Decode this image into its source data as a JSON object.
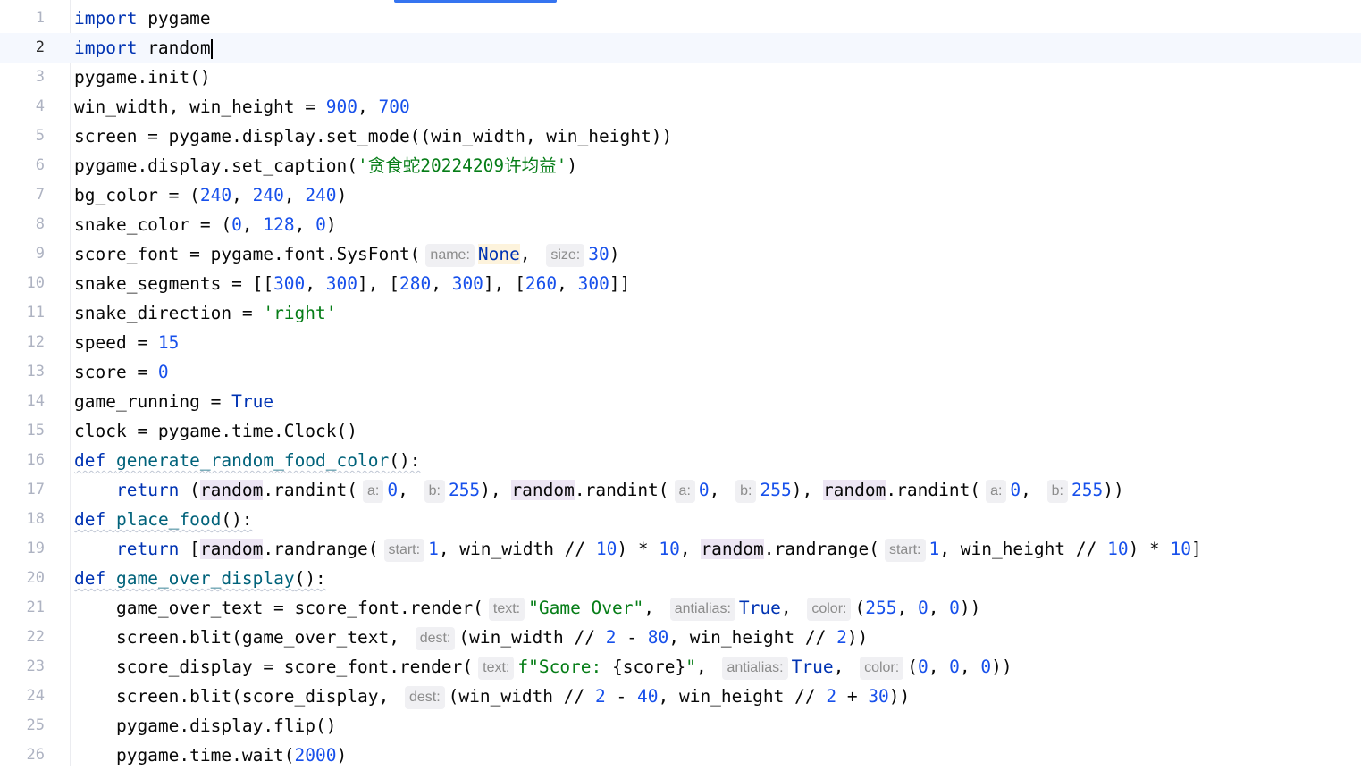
{
  "cursor_line": 2,
  "lines": [
    {
      "n": "1",
      "tokens": [
        {
          "t": "import",
          "c": "kw"
        },
        {
          "t": " pygame"
        }
      ]
    },
    {
      "n": "2",
      "tokens": [
        {
          "t": "import",
          "c": "kw"
        },
        {
          "t": " random"
        }
      ],
      "caret": true
    },
    {
      "n": "3",
      "tokens": [
        {
          "t": "pygame.init()"
        }
      ]
    },
    {
      "n": "4",
      "tokens": [
        {
          "t": "win_width, win_height = "
        },
        {
          "t": "900",
          "c": "num"
        },
        {
          "t": ", "
        },
        {
          "t": "700",
          "c": "num"
        }
      ]
    },
    {
      "n": "5",
      "tokens": [
        {
          "t": "screen = pygame.display.set_mode((win_width, win_height))"
        }
      ]
    },
    {
      "n": "6",
      "tokens": [
        {
          "t": "pygame.display.set_caption("
        },
        {
          "t": "'贪食蛇20224209许均益'",
          "c": "str"
        },
        {
          "t": ")"
        }
      ]
    },
    {
      "n": "7",
      "tokens": [
        {
          "t": "bg_color = ("
        },
        {
          "t": "240",
          "c": "num"
        },
        {
          "t": ", "
        },
        {
          "t": "240",
          "c": "num"
        },
        {
          "t": ", "
        },
        {
          "t": "240",
          "c": "num"
        },
        {
          "t": ")"
        }
      ]
    },
    {
      "n": "8",
      "tokens": [
        {
          "t": "snake_color = ("
        },
        {
          "t": "0",
          "c": "num"
        },
        {
          "t": ", "
        },
        {
          "t": "128",
          "c": "num"
        },
        {
          "t": ", "
        },
        {
          "t": "0",
          "c": "num"
        },
        {
          "t": ")"
        }
      ]
    },
    {
      "n": "9",
      "tokens": [
        {
          "t": "score_font = pygame.font.SysFont("
        },
        {
          "h": "name:"
        },
        {
          "t": "None",
          "c": "kw none-hl"
        },
        {
          "t": ", "
        },
        {
          "h": "size:"
        },
        {
          "t": "30",
          "c": "num"
        },
        {
          "t": ")"
        }
      ]
    },
    {
      "n": "10",
      "tokens": [
        {
          "t": "snake_segments = [["
        },
        {
          "t": "300",
          "c": "num"
        },
        {
          "t": ", "
        },
        {
          "t": "300",
          "c": "num"
        },
        {
          "t": "], ["
        },
        {
          "t": "280",
          "c": "num"
        },
        {
          "t": ", "
        },
        {
          "t": "300",
          "c": "num"
        },
        {
          "t": "], ["
        },
        {
          "t": "260",
          "c": "num"
        },
        {
          "t": ", "
        },
        {
          "t": "300",
          "c": "num"
        },
        {
          "t": "]]"
        }
      ]
    },
    {
      "n": "11",
      "tokens": [
        {
          "t": "snake_direction = "
        },
        {
          "t": "'right'",
          "c": "str"
        }
      ]
    },
    {
      "n": "12",
      "tokens": [
        {
          "t": "speed = "
        },
        {
          "t": "15",
          "c": "num"
        }
      ]
    },
    {
      "n": "13",
      "tokens": [
        {
          "t": "score = "
        },
        {
          "t": "0",
          "c": "num"
        }
      ]
    },
    {
      "n": "14",
      "tokens": [
        {
          "t": "game_running = "
        },
        {
          "t": "True",
          "c": "kw"
        }
      ]
    },
    {
      "n": "15",
      "tokens": [
        {
          "t": "clock = pygame.time.Clock()"
        }
      ]
    },
    {
      "n": "16",
      "tokens": [
        {
          "t": "def",
          "c": "kw wavy"
        },
        {
          "t": " ",
          "c": "wavy"
        },
        {
          "t": "generate_random_food_color",
          "c": "fn wavy"
        },
        {
          "t": "():",
          "c": "wavy"
        }
      ]
    },
    {
      "n": "17",
      "tokens": [
        {
          "t": "    "
        },
        {
          "t": "return",
          "c": "kw"
        },
        {
          "t": " ("
        },
        {
          "t": "random",
          "c": "mod-hl"
        },
        {
          "t": ".randint("
        },
        {
          "h": "a:"
        },
        {
          "t": "0",
          "c": "num"
        },
        {
          "t": ", "
        },
        {
          "h": "b:"
        },
        {
          "t": "255",
          "c": "num"
        },
        {
          "t": "), "
        },
        {
          "t": "random",
          "c": "mod-hl"
        },
        {
          "t": ".randint("
        },
        {
          "h": "a:"
        },
        {
          "t": "0",
          "c": "num"
        },
        {
          "t": ", "
        },
        {
          "h": "b:"
        },
        {
          "t": "255",
          "c": "num"
        },
        {
          "t": "), "
        },
        {
          "t": "random",
          "c": "mod-hl"
        },
        {
          "t": ".randint("
        },
        {
          "h": "a:"
        },
        {
          "t": "0",
          "c": "num"
        },
        {
          "t": ", "
        },
        {
          "h": "b:"
        },
        {
          "t": "255",
          "c": "num"
        },
        {
          "t": "))"
        }
      ]
    },
    {
      "n": "18",
      "tokens": [
        {
          "t": "def",
          "c": "kw wavy"
        },
        {
          "t": " ",
          "c": "wavy"
        },
        {
          "t": "place_food",
          "c": "fn wavy"
        },
        {
          "t": "():",
          "c": "wavy"
        }
      ]
    },
    {
      "n": "19",
      "tokens": [
        {
          "t": "    "
        },
        {
          "t": "return",
          "c": "kw"
        },
        {
          "t": " ["
        },
        {
          "t": "random",
          "c": "mod-hl"
        },
        {
          "t": ".randrange("
        },
        {
          "h": "start:"
        },
        {
          "t": "1",
          "c": "num"
        },
        {
          "t": ", win_width // "
        },
        {
          "t": "10",
          "c": "num"
        },
        {
          "t": ") * "
        },
        {
          "t": "10",
          "c": "num"
        },
        {
          "t": ", "
        },
        {
          "t": "random",
          "c": "mod-hl"
        },
        {
          "t": ".randrange("
        },
        {
          "h": "start:"
        },
        {
          "t": "1",
          "c": "num"
        },
        {
          "t": ", win_height // "
        },
        {
          "t": "10",
          "c": "num"
        },
        {
          "t": ") * "
        },
        {
          "t": "10",
          "c": "num"
        },
        {
          "t": "]"
        }
      ]
    },
    {
      "n": "20",
      "tokens": [
        {
          "t": "def",
          "c": "kw wavy"
        },
        {
          "t": " ",
          "c": "wavy"
        },
        {
          "t": "game_over_display",
          "c": "fn wavy"
        },
        {
          "t": "():",
          "c": "wavy"
        }
      ]
    },
    {
      "n": "21",
      "tokens": [
        {
          "t": "    game_over_text = score_font.render("
        },
        {
          "h": "text:"
        },
        {
          "t": "\"Game Over\"",
          "c": "str"
        },
        {
          "t": ", "
        },
        {
          "h": "antialias:"
        },
        {
          "t": "True",
          "c": "kw"
        },
        {
          "t": ", "
        },
        {
          "h": "color:"
        },
        {
          "t": "("
        },
        {
          "t": "255",
          "c": "num"
        },
        {
          "t": ", "
        },
        {
          "t": "0",
          "c": "num"
        },
        {
          "t": ", "
        },
        {
          "t": "0",
          "c": "num"
        },
        {
          "t": "))"
        }
      ]
    },
    {
      "n": "22",
      "tokens": [
        {
          "t": "    screen.blit(game_over_text, "
        },
        {
          "h": "dest:"
        },
        {
          "t": "(win_width // "
        },
        {
          "t": "2",
          "c": "num"
        },
        {
          "t": " - "
        },
        {
          "t": "80",
          "c": "num"
        },
        {
          "t": ", win_height // "
        },
        {
          "t": "2",
          "c": "num"
        },
        {
          "t": "))"
        }
      ]
    },
    {
      "n": "23",
      "tokens": [
        {
          "t": "    score_display = score_font.render("
        },
        {
          "h": "text:"
        },
        {
          "t": "f\"Score: ",
          "c": "str"
        },
        {
          "t": "{score}"
        },
        {
          "t": "\"",
          "c": "str"
        },
        {
          "t": ", "
        },
        {
          "h": "antialias:"
        },
        {
          "t": "True",
          "c": "kw"
        },
        {
          "t": ", "
        },
        {
          "h": "color:"
        },
        {
          "t": "("
        },
        {
          "t": "0",
          "c": "num"
        },
        {
          "t": ", "
        },
        {
          "t": "0",
          "c": "num"
        },
        {
          "t": ", "
        },
        {
          "t": "0",
          "c": "num"
        },
        {
          "t": "))"
        }
      ]
    },
    {
      "n": "24",
      "tokens": [
        {
          "t": "    screen.blit(score_display, "
        },
        {
          "h": "dest:"
        },
        {
          "t": "(win_width // "
        },
        {
          "t": "2",
          "c": "num"
        },
        {
          "t": " - "
        },
        {
          "t": "40",
          "c": "num"
        },
        {
          "t": ", win_height // "
        },
        {
          "t": "2",
          "c": "num"
        },
        {
          "t": " + "
        },
        {
          "t": "30",
          "c": "num"
        },
        {
          "t": "))"
        }
      ]
    },
    {
      "n": "25",
      "tokens": [
        {
          "t": "    pygame.display.flip()"
        }
      ]
    },
    {
      "n": "26",
      "tokens": [
        {
          "t": "    pygame.time.wait("
        },
        {
          "t": "2000",
          "c": "num"
        },
        {
          "t": ")"
        }
      ]
    }
  ]
}
